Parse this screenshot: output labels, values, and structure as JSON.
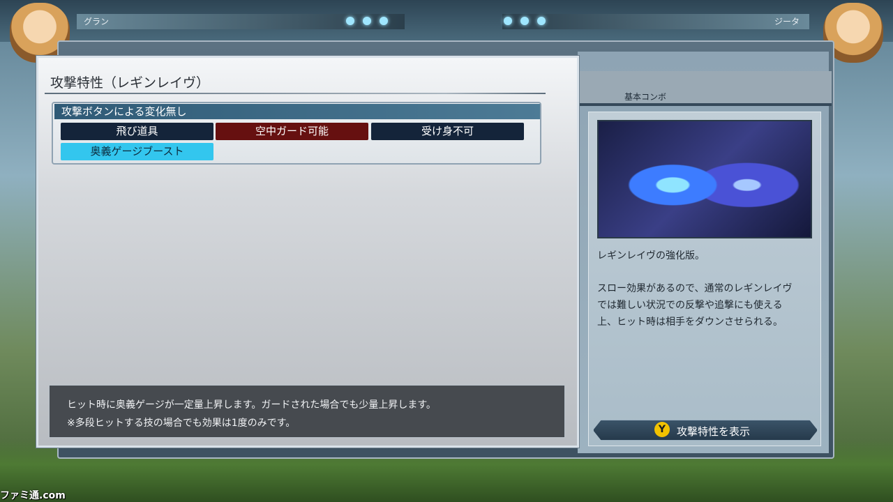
{
  "hud": {
    "player_left_name": "グラン",
    "player_right_name": "ジータ"
  },
  "attack_panel": {
    "title": "攻撃特性（レギンレイヴ）",
    "group_header": "攻撃ボタンによる変化無し",
    "tags": [
      {
        "label": "飛び道具",
        "style": "navy"
      },
      {
        "label": "空中ガード可能",
        "style": "red"
      },
      {
        "label": "受け身不可",
        "style": "navy"
      },
      {
        "label": "奥義ゲージブースト",
        "style": "cyan"
      }
    ],
    "description": [
      "ヒット時に奥義ゲージが一定量上昇します。ガードされた場合でも少量上昇します。",
      "※多段ヒットする技の場合でも効果は1度のみです。"
    ]
  },
  "combo_panel": {
    "header": "基本コンボ",
    "text_lines": [
      "レギンレイヴの強化版。",
      "スロー効果があるので、通常のレギンレイヴ",
      "では難しい状況での反撃や追撃にも使える",
      "上、ヒット時は相手をダウンさせられる。"
    ],
    "button_key": "Y",
    "button_label": "攻撃特性を表示"
  },
  "watermark": "ファミ通.com",
  "colors": {
    "tag_navy": "#14243a",
    "tag_red": "#661010",
    "tag_cyan": "#33c6ee",
    "header_blue": "#2f5a76",
    "y_button": "#f2c200"
  }
}
